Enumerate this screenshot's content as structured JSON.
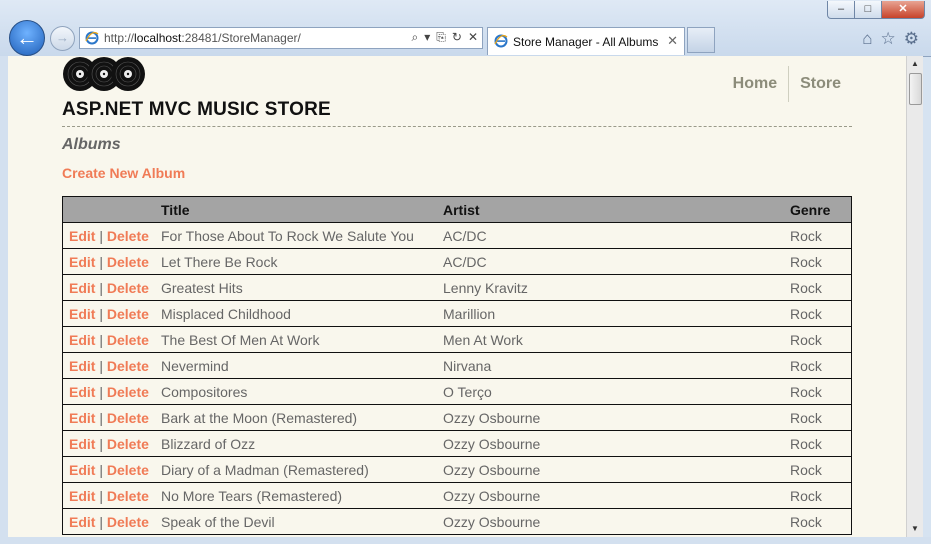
{
  "browser": {
    "url_prefix": "http://",
    "url_host": "localhost",
    "url_rest": ":28481/StoreManager/",
    "tab_title": "Store Manager - All Albums",
    "window_buttons": {
      "minimize": "–",
      "maximize": "□",
      "close": "✕"
    }
  },
  "site": {
    "title": "ASP.NET MVC MUSIC STORE",
    "nav": [
      {
        "label": "Home"
      },
      {
        "label": "Store"
      }
    ]
  },
  "page": {
    "heading": "Albums",
    "create_link": "Create New Album",
    "columns": {
      "title": "Title",
      "artist": "Artist",
      "genre": "Genre"
    },
    "edit_label": "Edit",
    "delete_label": "Delete",
    "separator": "|",
    "rows": [
      {
        "title": "For Those About To Rock We Salute You",
        "artist": "AC/DC",
        "genre": "Rock"
      },
      {
        "title": "Let There Be Rock",
        "artist": "AC/DC",
        "genre": "Rock"
      },
      {
        "title": "Greatest Hits",
        "artist": "Lenny Kravitz",
        "genre": "Rock"
      },
      {
        "title": "Misplaced Childhood",
        "artist": "Marillion",
        "genre": "Rock"
      },
      {
        "title": "The Best Of Men At Work",
        "artist": "Men At Work",
        "genre": "Rock"
      },
      {
        "title": "Nevermind",
        "artist": "Nirvana",
        "genre": "Rock"
      },
      {
        "title": "Compositores",
        "artist": "O Terço",
        "genre": "Rock"
      },
      {
        "title": "Bark at the Moon (Remastered)",
        "artist": "Ozzy Osbourne",
        "genre": "Rock"
      },
      {
        "title": "Blizzard of Ozz",
        "artist": "Ozzy Osbourne",
        "genre": "Rock"
      },
      {
        "title": "Diary of a Madman (Remastered)",
        "artist": "Ozzy Osbourne",
        "genre": "Rock"
      },
      {
        "title": "No More Tears (Remastered)",
        "artist": "Ozzy Osbourne",
        "genre": "Rock"
      },
      {
        "title": "Speak of the Devil",
        "artist": "Ozzy Osbourne",
        "genre": "Rock"
      }
    ]
  },
  "colors": {
    "accent": "#f07b56",
    "page_bg": "#f9f7ed",
    "header_bg": "#a4a4a4"
  },
  "icons": {
    "back": "back-arrow-icon",
    "forward": "forward-arrow-icon",
    "search": "search-icon",
    "refresh": "refresh-icon",
    "stop": "stop-icon",
    "compat": "compatibility-view-icon",
    "home": "home-icon",
    "favorites": "star-icon",
    "tools": "gear-icon",
    "logo": "vinyl-records-logo"
  }
}
